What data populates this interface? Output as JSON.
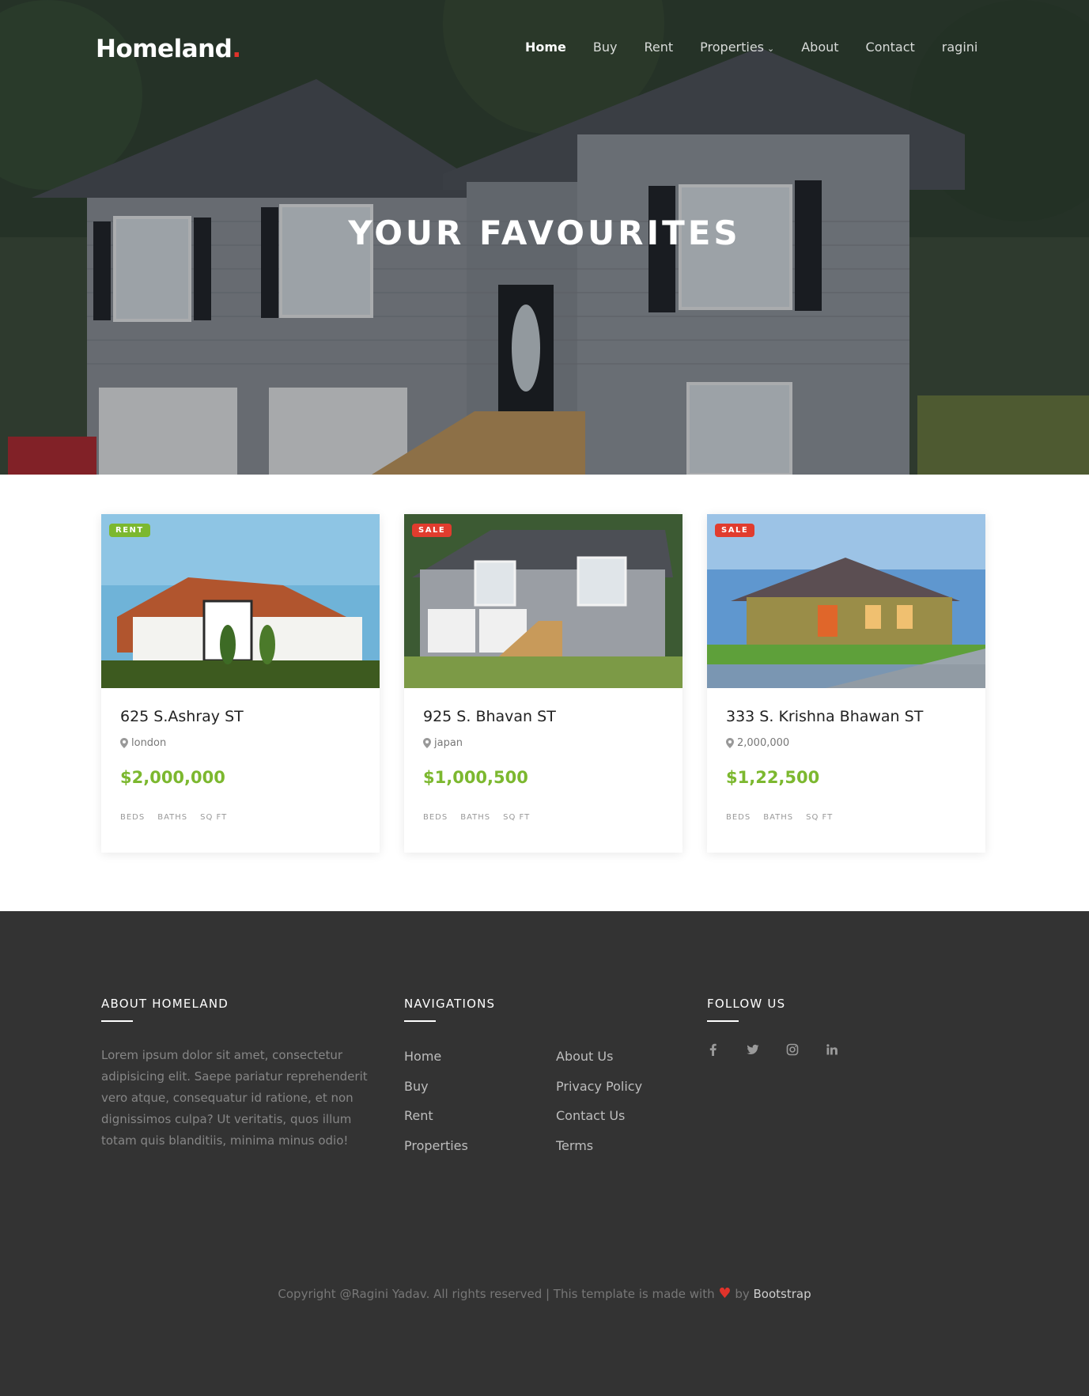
{
  "nav": {
    "logo_text": "Homeland",
    "logo_dot": ".",
    "items": [
      {
        "label": "Home"
      },
      {
        "label": "Buy"
      },
      {
        "label": "Rent"
      },
      {
        "label": "Properties"
      },
      {
        "label": "About"
      },
      {
        "label": "Contact"
      },
      {
        "label": "ragini"
      }
    ]
  },
  "hero": {
    "title": "YOUR FAVOURITES"
  },
  "listings": [
    {
      "badge": "RENT",
      "title": "625 S.Ashray ST",
      "location": "london",
      "price": "$2,000,000",
      "specs": [
        "BEDS",
        "BATHS",
        "SQ FT"
      ]
    },
    {
      "badge": "SALE",
      "title": "925 S. Bhavan ST",
      "location": "japan",
      "price": "$1,000,500",
      "specs": [
        "BEDS",
        "BATHS",
        "SQ FT"
      ]
    },
    {
      "badge": "SALE",
      "title": "333 S. Krishna Bhawan ST",
      "location": "2,000,000",
      "price": "$1,22,500",
      "specs": [
        "BEDS",
        "BATHS",
        "SQ FT"
      ]
    }
  ],
  "footer": {
    "about_heading": "ABOUT HOMELAND",
    "about_text": "Lorem ipsum dolor sit amet, consectetur adipisicing elit. Saepe pariatur reprehenderit vero atque, consequatur id ratione, et non dignissimos culpa? Ut veritatis, quos illum totam quis blanditiis, minima minus odio!",
    "nav_heading": "NAVIGATIONS",
    "nav_col1": [
      "Home",
      "Buy",
      "Rent",
      "Properties"
    ],
    "nav_col2": [
      "About Us",
      "Privacy Policy",
      "Contact Us",
      "Terms"
    ],
    "follow_heading": "FOLLOW US",
    "social_icons": [
      "facebook-icon",
      "twitter-icon",
      "instagram-icon",
      "linkedin-icon"
    ],
    "copyright_text": "Copyright @Ragini Yadav. All rights reserved | This template is made with",
    "copyright_by": "by",
    "copyright_brand": "Bootstrap"
  },
  "colors": {
    "accent_green": "#7cb82f",
    "sale_red": "#e13c2e",
    "footer_bg": "#333333"
  }
}
